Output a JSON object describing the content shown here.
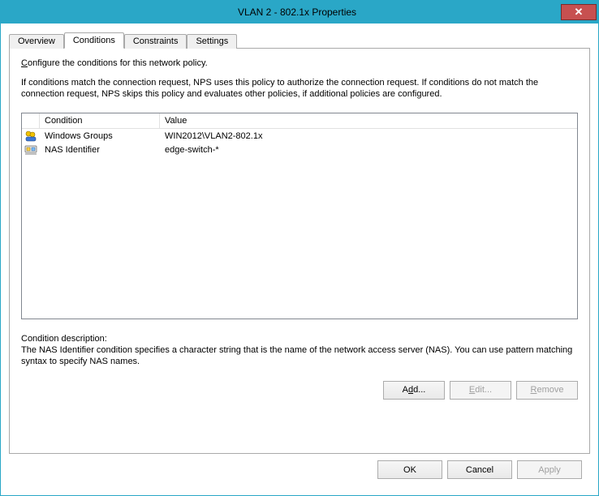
{
  "window": {
    "title": "VLAN 2 - 802.1x Properties",
    "close_glyph": "✕"
  },
  "tabs": {
    "overview": "Overview",
    "conditions": "Conditions",
    "constraints": "Constraints",
    "settings": "Settings"
  },
  "panel": {
    "configure_line": "onfigure the conditions for this network policy.",
    "configure_prefix": "C",
    "help_text": "If conditions match the connection request, NPS uses this policy to authorize the connection request. If conditions do not match the connection request, NPS skips this policy and evaluates other policies, if additional policies are configured."
  },
  "columns": {
    "condition": "Condition",
    "value": "Value"
  },
  "rows": [
    {
      "icon": "group-icon",
      "condition": "Windows Groups",
      "value": "WIN2012\\VLAN2-802.1x"
    },
    {
      "icon": "nas-icon",
      "condition": "NAS Identifier",
      "value": "edge-switch-*"
    }
  ],
  "description": {
    "label": "Condition description:",
    "text": "The NAS Identifier condition specifies a character string that is the name of the network access server (NAS). You can use pattern matching syntax to specify NAS names."
  },
  "buttons": {
    "add": "Add...",
    "edit": "Edit...",
    "remove": "Remove",
    "ok": "OK",
    "cancel": "Cancel",
    "apply": "Apply"
  }
}
